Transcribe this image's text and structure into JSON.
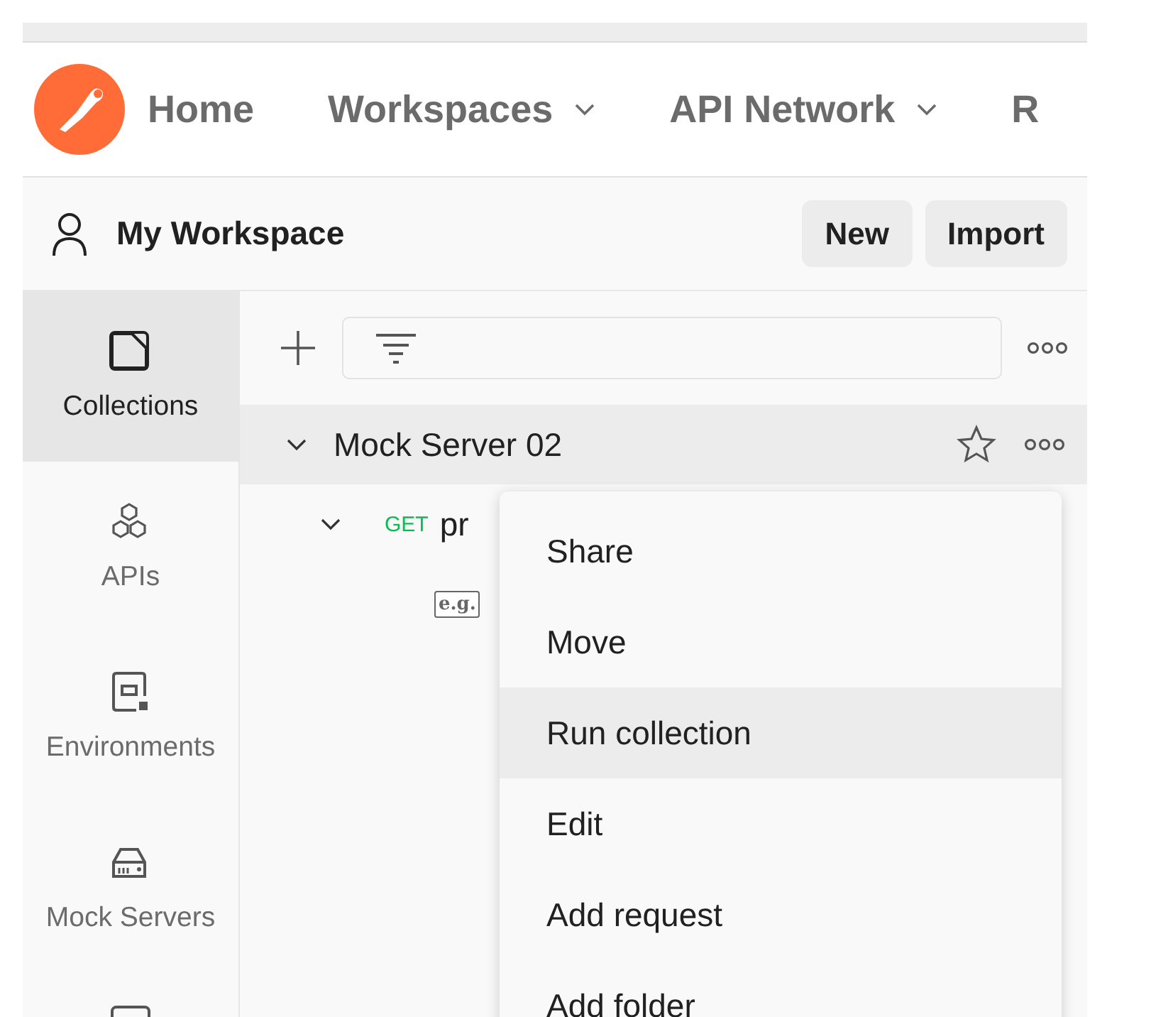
{
  "header": {
    "nav": [
      {
        "label": "Home",
        "has_menu": false
      },
      {
        "label": "Workspaces",
        "has_menu": true
      },
      {
        "label": "API Network",
        "has_menu": true
      },
      {
        "label": "R",
        "has_menu": false
      }
    ]
  },
  "workspace": {
    "name": "My Workspace",
    "buttons": [
      "New",
      "Import"
    ]
  },
  "sidebar": {
    "items": [
      {
        "kind": "collection",
        "label": "Collections",
        "selected": true
      },
      {
        "kind": "api",
        "label": "APIs",
        "selected": false
      },
      {
        "kind": "environment",
        "label": "Environments",
        "selected": false
      },
      {
        "kind": "mock",
        "label": "Mock Servers",
        "selected": false
      },
      {
        "kind": "monitor",
        "selected": false
      }
    ]
  },
  "tree": [
    {
      "kind": "collection",
      "name": "Mock Server 02",
      "expanded": true,
      "children": [
        {
          "kind": "request",
          "method": "GET",
          "name": "pr",
          "expanded": true,
          "children": [
            {
              "kind": "example",
              "badge": "e.g."
            }
          ]
        }
      ]
    }
  ],
  "context_menu": {
    "items": [
      {
        "label": "Share",
        "selected": false
      },
      {
        "label": "Move",
        "selected": false
      },
      {
        "label": "Run collection",
        "selected": true
      },
      {
        "label": "Edit",
        "selected": false
      },
      {
        "label": "Add request",
        "selected": false
      },
      {
        "label": "Add folder",
        "selected": false
      }
    ]
  }
}
